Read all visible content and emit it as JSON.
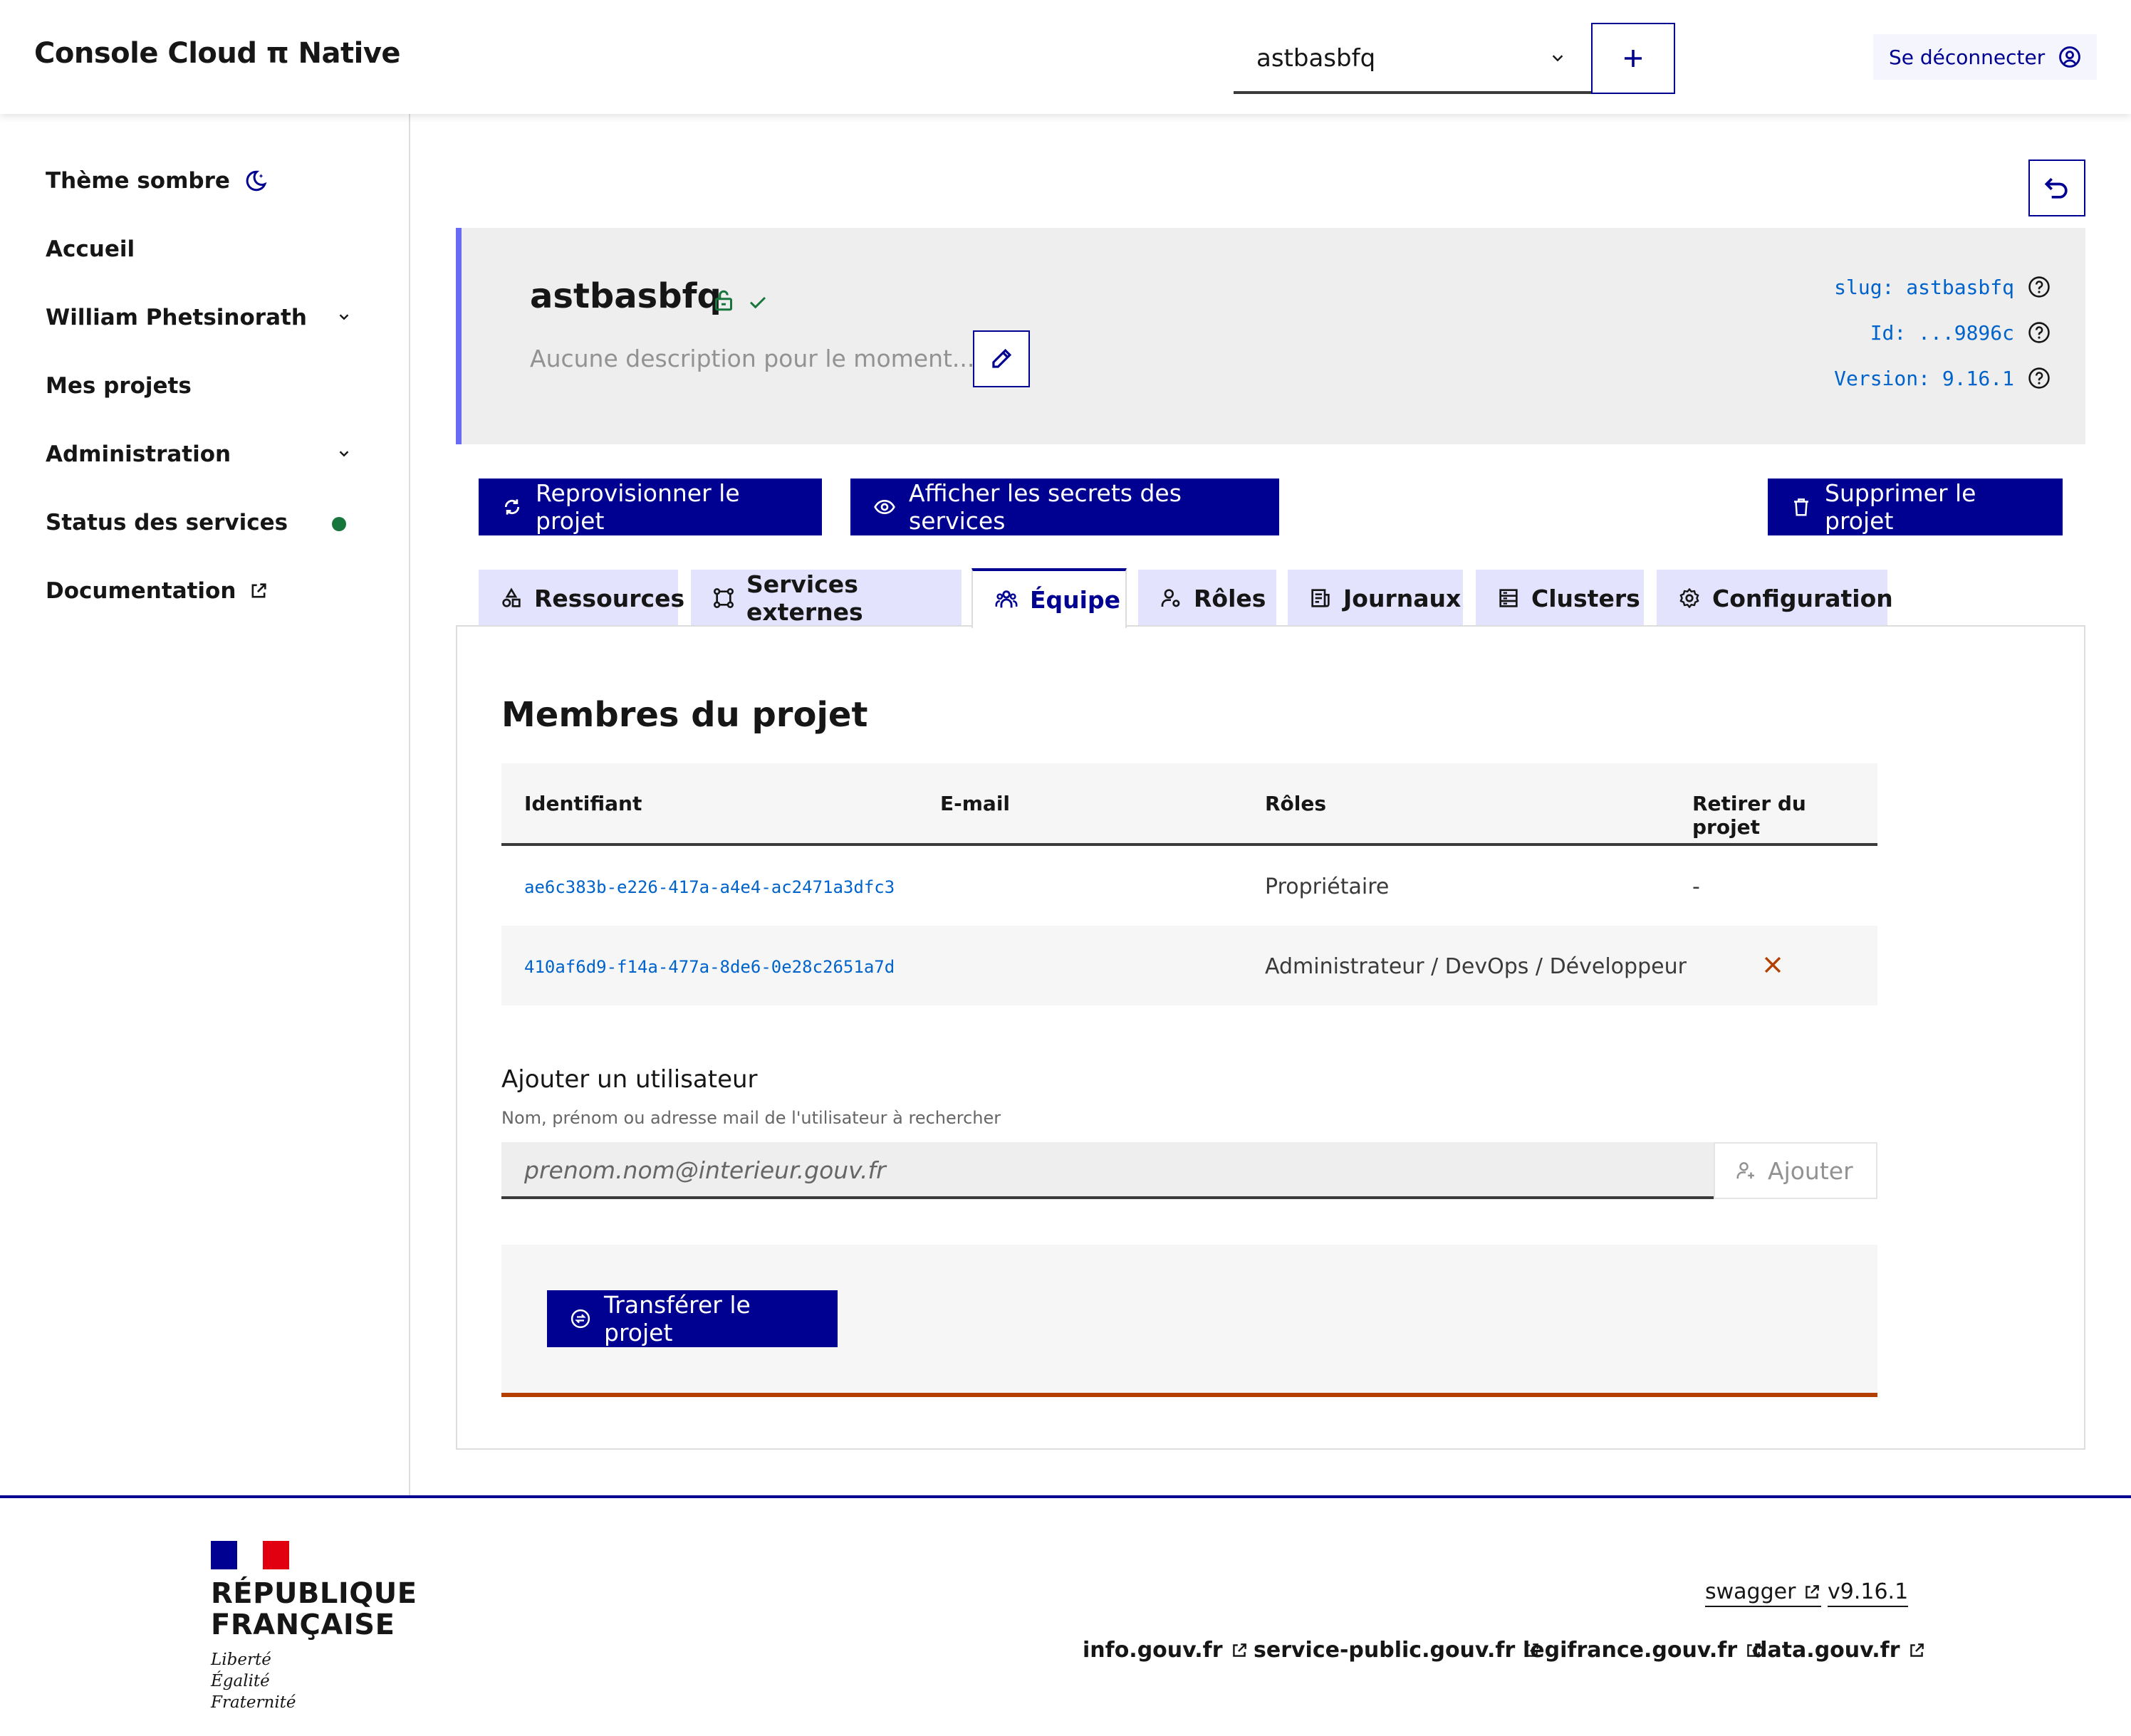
{
  "header": {
    "app_title": "Console Cloud π Native",
    "project_select": {
      "value": "astbasbfq"
    },
    "logout_label": "Se déconnecter"
  },
  "sidebar": {
    "items": [
      {
        "label": "Thème sombre",
        "icon": "moon-icon"
      },
      {
        "label": "Accueil"
      },
      {
        "label": "William Phetsinorath",
        "icon": "chevron-down-icon"
      },
      {
        "label": "Mes projets"
      },
      {
        "label": "Administration",
        "icon": "chevron-down-icon"
      },
      {
        "label": "Status des services",
        "status_color": "#18753c"
      },
      {
        "label": "Documentation",
        "icon": "external-link-icon"
      }
    ]
  },
  "project": {
    "name": "astbasbfq",
    "description": "Aucune description pour le moment...",
    "meta": {
      "slug": "slug: astbasbfq",
      "id": "Id: ...9896c",
      "version": "Version: 9.16.1"
    }
  },
  "actions": {
    "reprovision": "Reprovisionner le projet",
    "show_secrets": "Afficher les secrets des services",
    "delete": "Supprimer le projet"
  },
  "tabs": [
    {
      "label": "Ressources",
      "icon": "resources-icon"
    },
    {
      "label": "Services externes",
      "icon": "external-services-icon"
    },
    {
      "label": "Équipe",
      "icon": "team-icon",
      "active": true
    },
    {
      "label": "Rôles",
      "icon": "roles-icon"
    },
    {
      "label": "Journaux",
      "icon": "logs-icon"
    },
    {
      "label": "Clusters",
      "icon": "clusters-icon"
    },
    {
      "label": "Configuration",
      "icon": "gear-icon"
    }
  ],
  "members": {
    "title": "Membres du projet",
    "columns": [
      "Identifiant",
      "E-mail",
      "Rôles",
      "Retirer du projet"
    ],
    "rows": [
      {
        "id": "ae6c383b-e226-417a-a4e4-ac2471a3dfc3",
        "email": "",
        "roles": "Propriétaire",
        "remove": "-"
      },
      {
        "id": "410af6d9-f14a-477a-8de6-0e28c2651a7d",
        "email": "",
        "roles": "Administrateur / DevOps / Développeur",
        "remove": ""
      }
    ]
  },
  "add_user": {
    "label": "Ajouter un utilisateur",
    "hint": "Nom, prénom ou adresse mail de l'utilisateur à rechercher",
    "placeholder": "prenom.nom@interieur.gouv.fr",
    "button": "Ajouter"
  },
  "transfer": {
    "button": "Transférer le projet"
  },
  "footer": {
    "brand_line1": "RÉPUBLIQUE",
    "brand_line2": "FRANÇAISE",
    "devise_1": "Liberté",
    "devise_2": "Égalité",
    "devise_3": "Fraternité",
    "swagger": "swagger",
    "version": "v9.16.1",
    "links": [
      "info.gouv.fr",
      "service-public.gouv.fr",
      "legifrance.gouv.fr",
      "data.gouv.fr"
    ]
  },
  "colors": {
    "primary": "#000091",
    "accent_border": "#6a6af4",
    "success": "#18753c",
    "danger": "#b34000",
    "link_mono": "#0063cb"
  }
}
